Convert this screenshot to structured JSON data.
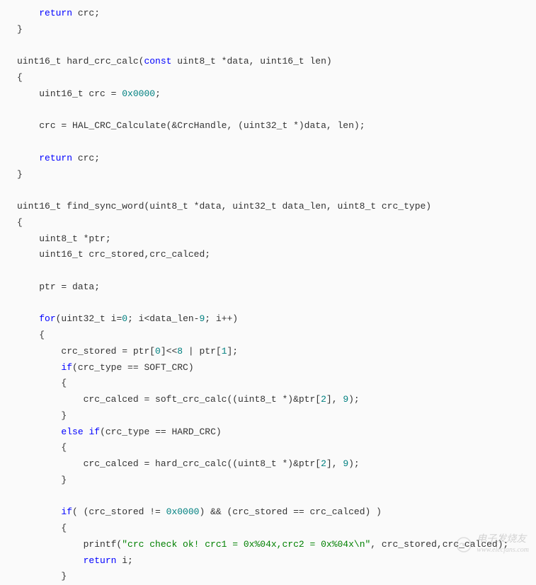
{
  "code": {
    "lines": [
      {
        "indent": 1,
        "tokens": [
          {
            "t": "keyword",
            "v": "return"
          },
          {
            "t": "plain",
            "v": " crc;"
          }
        ]
      },
      {
        "indent": 0,
        "tokens": [
          {
            "t": "plain",
            "v": "}"
          }
        ]
      },
      {
        "indent": 0,
        "tokens": []
      },
      {
        "indent": 0,
        "tokens": [
          {
            "t": "plain",
            "v": "uint16_t hard_crc_calc("
          },
          {
            "t": "keyword",
            "v": "const"
          },
          {
            "t": "plain",
            "v": " uint8_t *data, uint16_t len)"
          }
        ]
      },
      {
        "indent": 0,
        "tokens": [
          {
            "t": "plain",
            "v": "{"
          }
        ]
      },
      {
        "indent": 1,
        "tokens": [
          {
            "t": "plain",
            "v": "uint16_t crc = "
          },
          {
            "t": "number",
            "v": "0x0000"
          },
          {
            "t": "plain",
            "v": ";"
          }
        ]
      },
      {
        "indent": 0,
        "tokens": []
      },
      {
        "indent": 1,
        "tokens": [
          {
            "t": "plain",
            "v": "crc = HAL_CRC_Calculate(&CrcHandle, (uint32_t *)data, len);"
          }
        ]
      },
      {
        "indent": 0,
        "tokens": []
      },
      {
        "indent": 1,
        "tokens": [
          {
            "t": "keyword",
            "v": "return"
          },
          {
            "t": "plain",
            "v": " crc;"
          }
        ]
      },
      {
        "indent": 0,
        "tokens": [
          {
            "t": "plain",
            "v": "}"
          }
        ]
      },
      {
        "indent": 0,
        "tokens": []
      },
      {
        "indent": 0,
        "tokens": [
          {
            "t": "plain",
            "v": "uint16_t find_sync_word(uint8_t *data, uint32_t data_len, uint8_t crc_type)"
          }
        ]
      },
      {
        "indent": 0,
        "tokens": [
          {
            "t": "plain",
            "v": "{"
          }
        ]
      },
      {
        "indent": 1,
        "tokens": [
          {
            "t": "plain",
            "v": "uint8_t *ptr;"
          }
        ]
      },
      {
        "indent": 1,
        "tokens": [
          {
            "t": "plain",
            "v": "uint16_t crc_stored,crc_calced;"
          }
        ]
      },
      {
        "indent": 0,
        "tokens": []
      },
      {
        "indent": 1,
        "tokens": [
          {
            "t": "plain",
            "v": "ptr = data;"
          }
        ]
      },
      {
        "indent": 0,
        "tokens": []
      },
      {
        "indent": 1,
        "tokens": [
          {
            "t": "keyword",
            "v": "for"
          },
          {
            "t": "plain",
            "v": "(uint32_t i="
          },
          {
            "t": "number",
            "v": "0"
          },
          {
            "t": "plain",
            "v": "; i<data_len-"
          },
          {
            "t": "number",
            "v": "9"
          },
          {
            "t": "plain",
            "v": "; i++)"
          }
        ]
      },
      {
        "indent": 1,
        "tokens": [
          {
            "t": "plain",
            "v": "{"
          }
        ]
      },
      {
        "indent": 2,
        "tokens": [
          {
            "t": "plain",
            "v": "crc_stored = ptr["
          },
          {
            "t": "number",
            "v": "0"
          },
          {
            "t": "plain",
            "v": "]<<"
          },
          {
            "t": "number",
            "v": "8"
          },
          {
            "t": "plain",
            "v": " | ptr["
          },
          {
            "t": "number",
            "v": "1"
          },
          {
            "t": "plain",
            "v": "];"
          }
        ]
      },
      {
        "indent": 2,
        "tokens": [
          {
            "t": "keyword",
            "v": "if"
          },
          {
            "t": "plain",
            "v": "(crc_type == SOFT_CRC)"
          }
        ]
      },
      {
        "indent": 2,
        "tokens": [
          {
            "t": "plain",
            "v": "{"
          }
        ]
      },
      {
        "indent": 3,
        "tokens": [
          {
            "t": "plain",
            "v": "crc_calced = soft_crc_calc((uint8_t *)&ptr["
          },
          {
            "t": "number",
            "v": "2"
          },
          {
            "t": "plain",
            "v": "], "
          },
          {
            "t": "number",
            "v": "9"
          },
          {
            "t": "plain",
            "v": ");"
          }
        ]
      },
      {
        "indent": 2,
        "tokens": [
          {
            "t": "plain",
            "v": "}"
          }
        ]
      },
      {
        "indent": 2,
        "tokens": [
          {
            "t": "keyword",
            "v": "else"
          },
          {
            "t": "plain",
            "v": " "
          },
          {
            "t": "keyword",
            "v": "if"
          },
          {
            "t": "plain",
            "v": "(crc_type == HARD_CRC)"
          }
        ]
      },
      {
        "indent": 2,
        "tokens": [
          {
            "t": "plain",
            "v": "{"
          }
        ]
      },
      {
        "indent": 3,
        "tokens": [
          {
            "t": "plain",
            "v": "crc_calced = hard_crc_calc((uint8_t *)&ptr["
          },
          {
            "t": "number",
            "v": "2"
          },
          {
            "t": "plain",
            "v": "], "
          },
          {
            "t": "number",
            "v": "9"
          },
          {
            "t": "plain",
            "v": ");"
          }
        ]
      },
      {
        "indent": 2,
        "tokens": [
          {
            "t": "plain",
            "v": "}"
          }
        ]
      },
      {
        "indent": 0,
        "tokens": []
      },
      {
        "indent": 2,
        "tokens": [
          {
            "t": "keyword",
            "v": "if"
          },
          {
            "t": "plain",
            "v": "( (crc_stored != "
          },
          {
            "t": "number",
            "v": "0x0000"
          },
          {
            "t": "plain",
            "v": ") && (crc_stored == crc_calced) )"
          }
        ]
      },
      {
        "indent": 2,
        "tokens": [
          {
            "t": "plain",
            "v": "{"
          }
        ]
      },
      {
        "indent": 3,
        "tokens": [
          {
            "t": "plain",
            "v": "printf("
          },
          {
            "t": "string",
            "v": "\"crc check ok! crc1 = 0x%04x,crc2 = 0x%04x\\n\""
          },
          {
            "t": "plain",
            "v": ", crc_stored,crc_calced);"
          }
        ]
      },
      {
        "indent": 3,
        "tokens": [
          {
            "t": "keyword",
            "v": "return"
          },
          {
            "t": "plain",
            "v": " i;"
          }
        ]
      },
      {
        "indent": 2,
        "tokens": [
          {
            "t": "plain",
            "v": "}"
          }
        ]
      }
    ]
  },
  "watermark": {
    "chinese": "电子发烧友",
    "url": "www.elecfans.com"
  }
}
